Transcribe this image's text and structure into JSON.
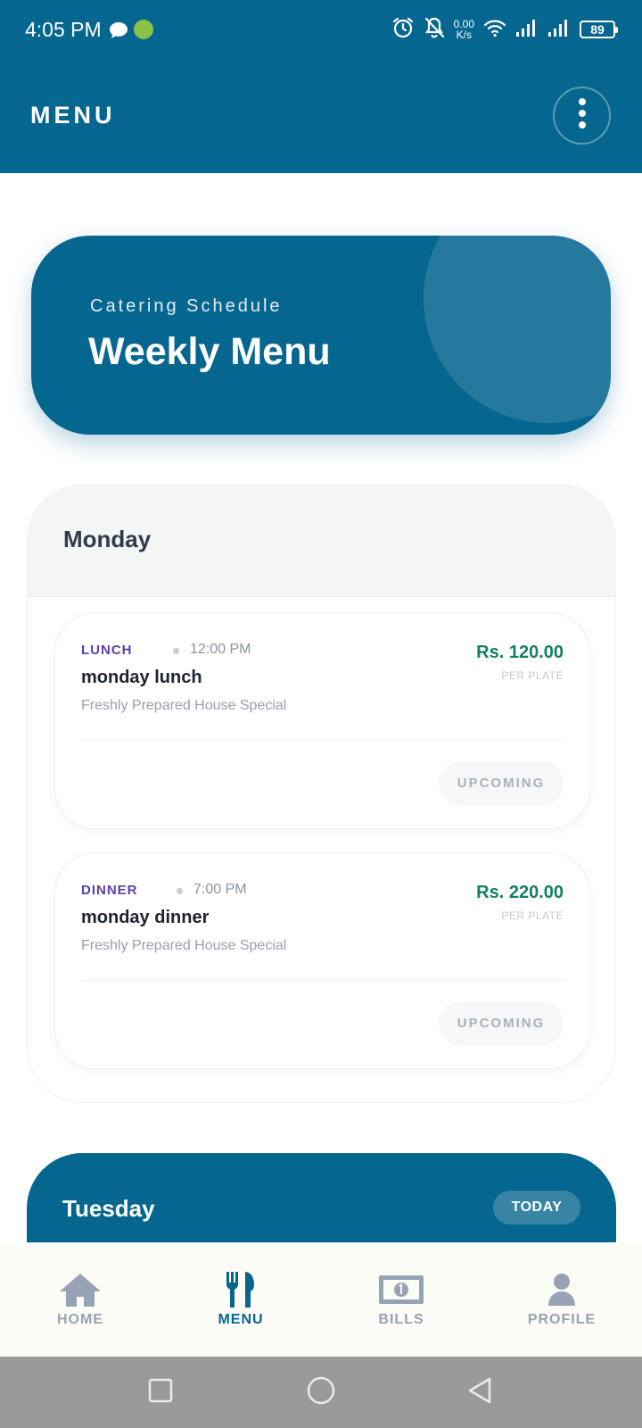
{
  "status_bar": {
    "time": "4:05 PM",
    "net_speed_value": "0.00",
    "net_speed_unit": "K/s",
    "battery": "89"
  },
  "header": {
    "title": "MENU"
  },
  "hero": {
    "subtitle": "Catering Schedule",
    "title": "Weekly Menu"
  },
  "days": [
    {
      "name": "Monday",
      "meals": [
        {
          "type": "LUNCH",
          "time": "12:00 PM",
          "name": "monday lunch",
          "description": "Freshly Prepared House Special",
          "price": "Rs. 120.00",
          "unit": "PER PLATE",
          "status": "UPCOMING"
        },
        {
          "type": "DINNER",
          "time": "7:00 PM",
          "name": "monday dinner",
          "description": "Freshly Prepared House Special",
          "price": "Rs. 220.00",
          "unit": "PER PLATE",
          "status": "UPCOMING"
        }
      ]
    },
    {
      "name": "Tuesday",
      "badge": "TODAY"
    }
  ],
  "bottom_nav": [
    {
      "label": "HOME",
      "icon": "home-icon",
      "active": false
    },
    {
      "label": "MENU",
      "icon": "cutlery-icon",
      "active": true
    },
    {
      "label": "BILLS",
      "icon": "banknote-icon",
      "active": false
    },
    {
      "label": "PROFILE",
      "icon": "user-icon",
      "active": false
    }
  ],
  "colors": {
    "primary": "#05668f",
    "price_green": "#128061",
    "meal_type_purple": "#5a3fb0",
    "nav_inactive": "#97a3b4"
  }
}
